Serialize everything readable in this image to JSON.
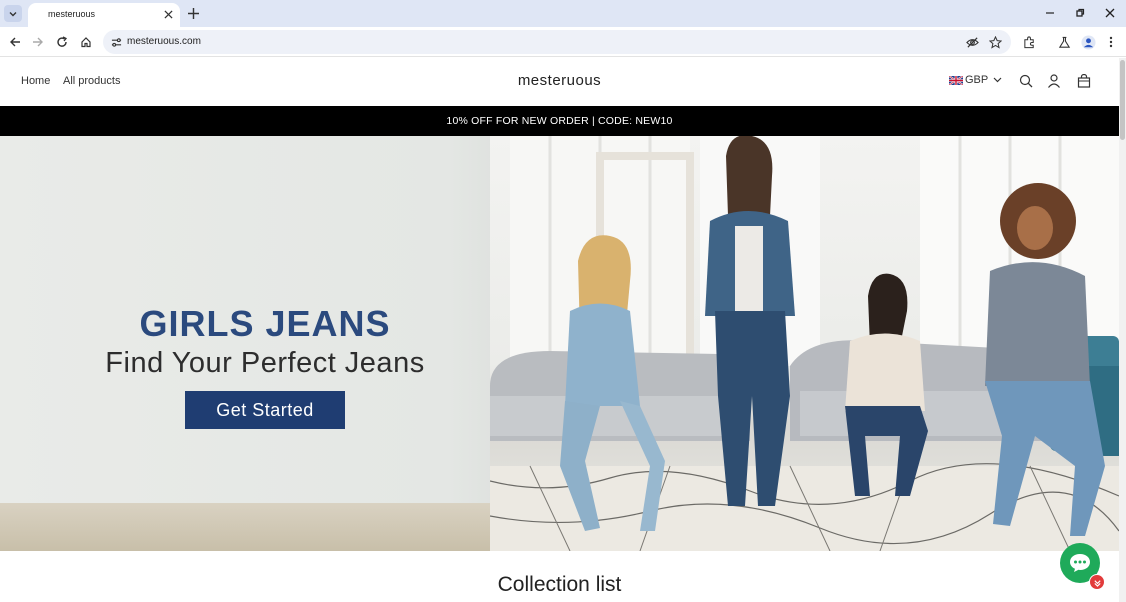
{
  "browser": {
    "tab_title": "mesteruous",
    "url": "mesteruous.com"
  },
  "header": {
    "nav": [
      "Home",
      "All products"
    ],
    "brand": "mesteruous",
    "currency": "GBP"
  },
  "promo": {
    "text": "10% OFF FOR NEW ORDER | CODE: NEW10"
  },
  "hero": {
    "title": "GIRLS JEANS",
    "subtitle": "Find Your Perfect Jeans",
    "cta": "Get Started"
  },
  "collection": {
    "title": "Collection list"
  },
  "colors": {
    "promo_bg": "#000000",
    "hero_title": "#2b4a7e",
    "cta_bg": "#1f3d72",
    "chat": "#1faa5a",
    "badge": "#e23b3b"
  },
  "icons": [
    "tab-list-icon",
    "close-icon",
    "plus-icon",
    "minimize-icon",
    "restore-icon",
    "back-icon",
    "forward-icon",
    "reload-icon",
    "home-icon",
    "site-info-icon",
    "eye-off-icon",
    "star-icon",
    "extensions-icon",
    "labs-icon",
    "profile-icon",
    "menu-icon",
    "flag-icon",
    "chevron-down-icon",
    "search-icon",
    "account-icon",
    "cart-icon",
    "chat-icon"
  ]
}
